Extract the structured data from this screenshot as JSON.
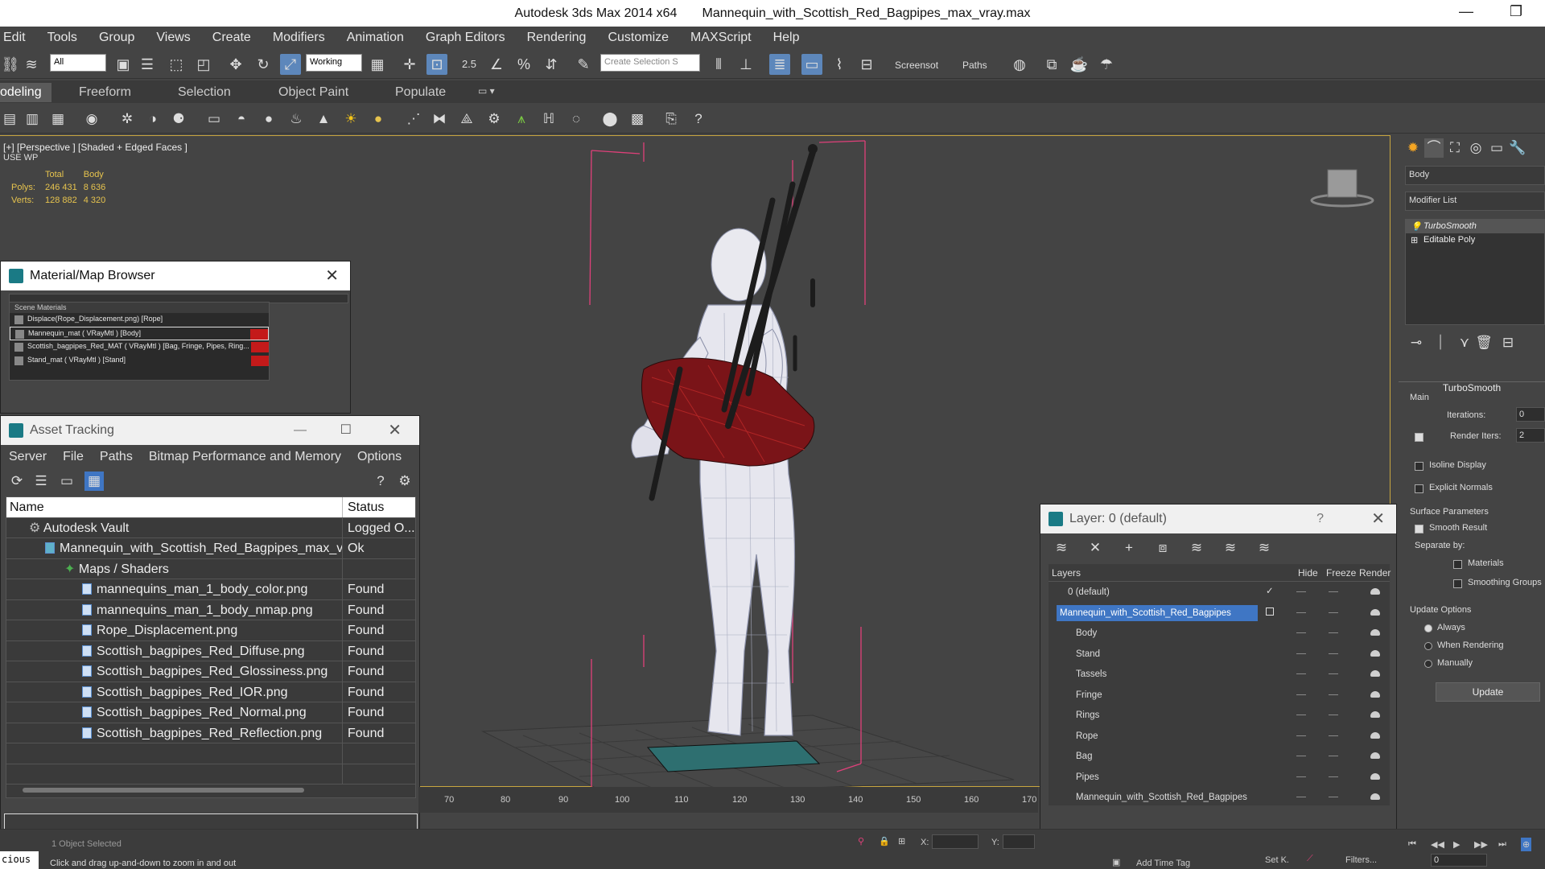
{
  "window": {
    "app_title": "Autodesk 3ds Max  2014 x64",
    "file_title": "Mannequin_with_Scottish_Red_Bagpipes_max_vray.max"
  },
  "menu": [
    "Edit",
    "Tools",
    "Group",
    "Views",
    "Create",
    "Modifiers",
    "Animation",
    "Graph Editors",
    "Rendering",
    "Customize",
    "MAXScript",
    "Help"
  ],
  "toolbar": {
    "filter_value": "All",
    "coord_value": "Working",
    "selection_set_placeholder": "Create Selection S",
    "snap_angle_label": "2.5",
    "screenshot_label": "Screensot",
    "paths_label": "Paths"
  },
  "ribbon_tabs": [
    "odeling",
    "Freeform",
    "Selection",
    "Object Paint",
    "Populate"
  ],
  "viewport": {
    "label": "[+] [Perspective ] [Shaded + Edged Faces ]",
    "sub_label": "USE WP",
    "stats": {
      "col_total": "Total",
      "col_body": "Body",
      "polys_label": "Polys:",
      "polys_total": "246 431",
      "polys_body": "8 636",
      "verts_label": "Verts:",
      "verts_total": "128 882",
      "verts_body": "4 320"
    }
  },
  "material_browser": {
    "title": "Material/Map Browser",
    "section": "Scene Materials",
    "items": [
      "Displace(Rope_Displacement.png) [Rope]",
      "Mannequin_mat  ( VRayMtl ) [Body]",
      "Scottish_bagpipes_Red_MAT  ( VRayMtl ) [Bag, Fringe, Pipes, Ring...",
      "Stand_mat  ( VRayMtl ) [Stand]"
    ]
  },
  "asset_tracking": {
    "title": "Asset Tracking",
    "menu": [
      "Server",
      "File",
      "Paths",
      "Bitmap Performance and Memory",
      "Options"
    ],
    "col_name": "Name",
    "col_status": "Status",
    "rows": [
      {
        "name": "Autodesk Vault",
        "status": "Logged O..."
      },
      {
        "name": "Mannequin_with_Scottish_Red_Bagpipes_max_v...",
        "status": "Ok"
      },
      {
        "name": "Maps / Shaders",
        "status": ""
      },
      {
        "name": "mannequins_man_1_body_color.png",
        "status": "Found"
      },
      {
        "name": "mannequins_man_1_body_nmap.png",
        "status": "Found"
      },
      {
        "name": "Rope_Displacement.png",
        "status": "Found"
      },
      {
        "name": "Scottish_bagpipes_Red_Diffuse.png",
        "status": "Found"
      },
      {
        "name": "Scottish_bagpipes_Red_Glossiness.png",
        "status": "Found"
      },
      {
        "name": "Scottish_bagpipes_Red_IOR.png",
        "status": "Found"
      },
      {
        "name": "Scottish_bagpipes_Red_Normal.png",
        "status": "Found"
      },
      {
        "name": "Scottish_bagpipes_Red_Reflection.png",
        "status": "Found"
      }
    ]
  },
  "layer_dialog": {
    "title": "Layer: 0 (default)",
    "help": "?",
    "col_layers": "Layers",
    "col_hide": "Hide",
    "col_freeze": "Freeze",
    "col_render": "Render",
    "rows": [
      "0 (default)",
      "Mannequin_with_Scottish_Red_Bagpipes",
      "Body",
      "Stand",
      "Tassels",
      "Fringe",
      "Rings",
      "Rope",
      "Bag",
      "Pipes",
      "Mannequin_with_Scottish_Red_Bagpipes"
    ]
  },
  "command_panel": {
    "object_name": "Body",
    "modifier_list": "Modifier List",
    "stack": [
      "TurboSmooth",
      "Editable Poly"
    ],
    "rollout_title": "TurboSmooth",
    "main_label": "Main",
    "iterations_label": "Iterations:",
    "iterations_value": "0",
    "render_iters_label": "Render Iters:",
    "render_iters_value": "2",
    "isoline": "Isoline Display",
    "explicit_normals": "Explicit Normals",
    "surface_params": "Surface Parameters",
    "smooth_result": "Smooth Result",
    "separate_by": "Separate by:",
    "materials": "Materials",
    "smoothing_groups": "Smoothing Groups",
    "update_options": "Update Options",
    "always": "Always",
    "when_rendering": "When Rendering",
    "manually": "Manually",
    "update_button": "Update"
  },
  "timeline": {
    "ticks": [
      "70",
      "80",
      "90",
      "100",
      "110",
      "120",
      "130",
      "140",
      "150",
      "160",
      "170"
    ]
  },
  "status": {
    "selection": "1 Object Selected",
    "prompt": "Click and drag up-and-down to zoom in and out",
    "maxscript": "cious",
    "x_label": "X:",
    "y_label": "Y:",
    "add_time_tag": "Add Time Tag",
    "set_key": "Set K.",
    "filters": "Filters...",
    "frame_value": "0"
  }
}
